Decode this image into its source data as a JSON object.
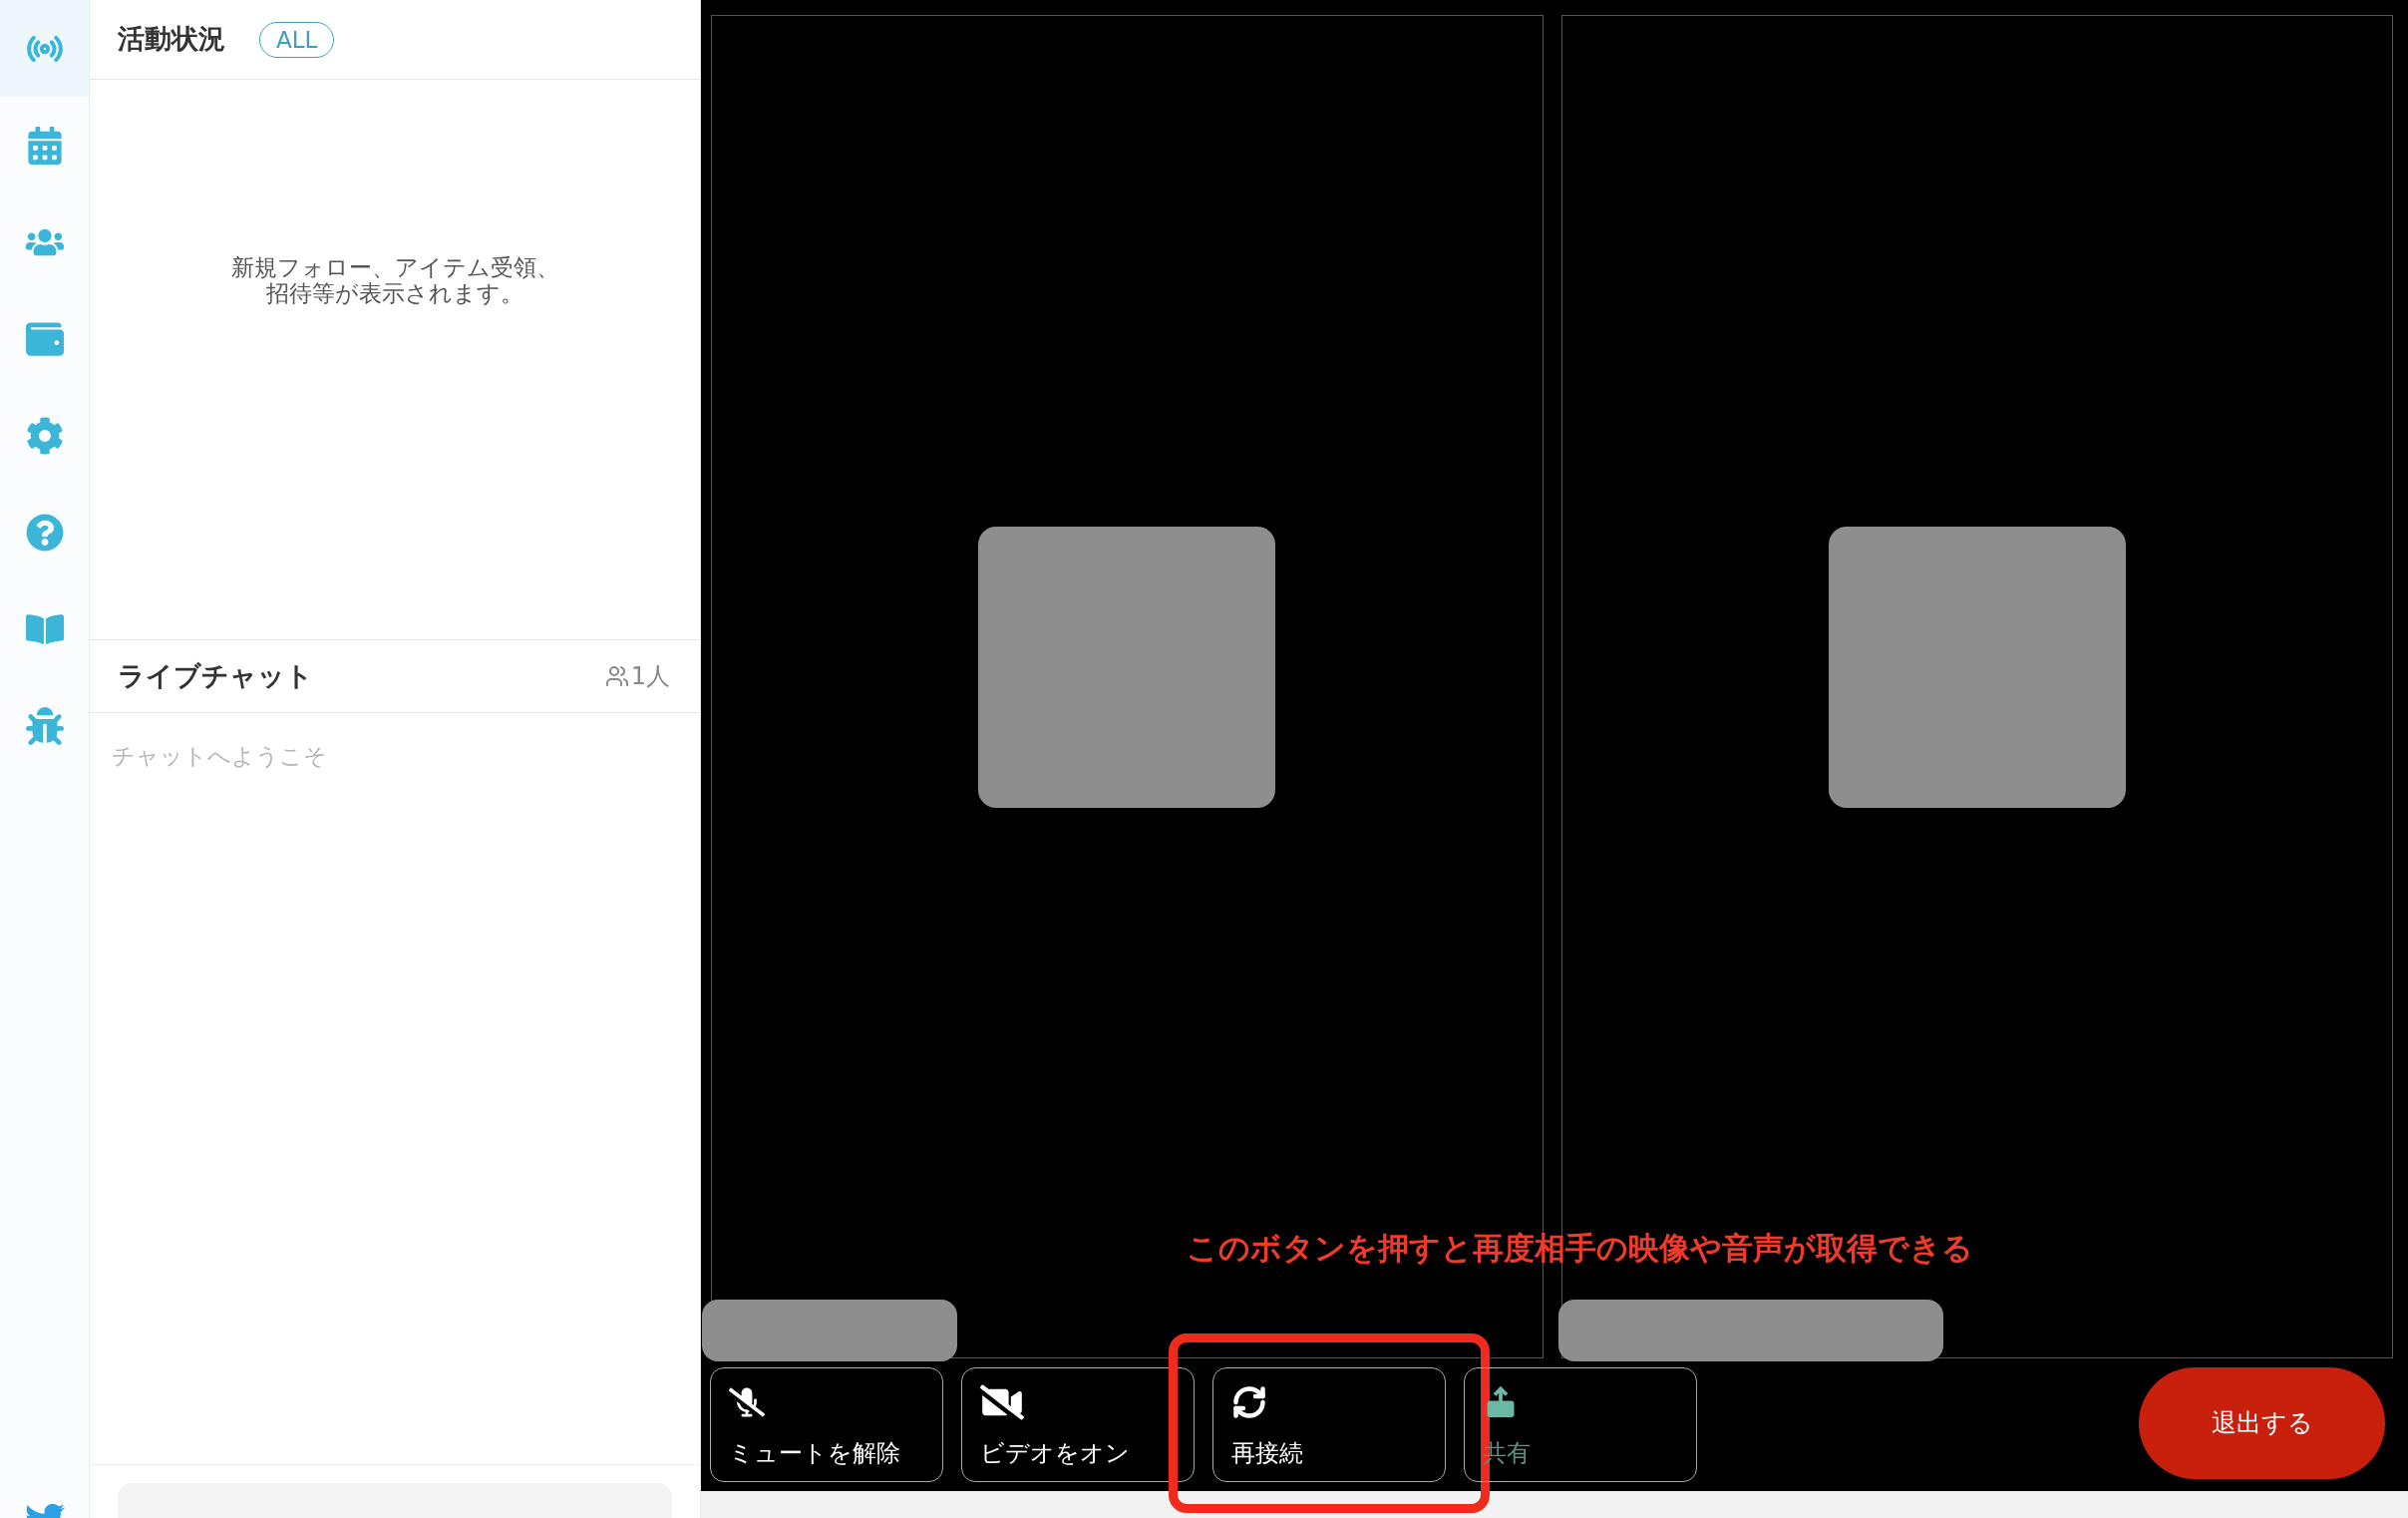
{
  "sidebar": {
    "items": [
      {
        "kind": "broadcast",
        "selected": true
      },
      {
        "kind": "calendar",
        "selected": false
      },
      {
        "kind": "users",
        "selected": false
      },
      {
        "kind": "wallet",
        "selected": false
      },
      {
        "kind": "settings",
        "selected": false
      },
      {
        "kind": "help",
        "selected": false
      },
      {
        "kind": "book",
        "selected": false
      },
      {
        "kind": "bug",
        "selected": false
      }
    ]
  },
  "activity": {
    "title": "活動状況",
    "filter": "ALL",
    "empty_message": "新規フォロー、アイテム受領、招待等が表示されます。"
  },
  "chat": {
    "title": "ライブチャット",
    "member_count": "1人",
    "welcome": "チャットへようこそ"
  },
  "controls": [
    {
      "label": "ミュートを解除",
      "kind": "mic-off",
      "disabled": false,
      "highlighted": false
    },
    {
      "label": "ビデオをオン",
      "kind": "video-off",
      "disabled": false,
      "highlighted": false
    },
    {
      "label": "再接続",
      "kind": "reconnect",
      "disabled": false,
      "highlighted": true
    },
    {
      "label": "共有",
      "kind": "share",
      "disabled": true,
      "highlighted": false
    }
  ],
  "leave_button": "退出する",
  "annotation": {
    "text": "このボタンを押すと再度相手の映像や音声が取得できる"
  }
}
